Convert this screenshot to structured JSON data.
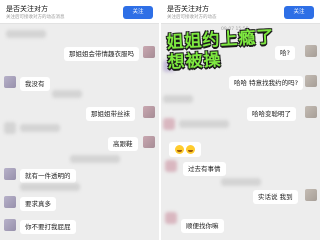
{
  "left": {
    "follow_title": "是否关注对方",
    "follow_sub": "关注后可接收对方的动态消息",
    "follow_btn": "关注",
    "time": "",
    "messages": {
      "m1": "那姐姐会带情趣衣服吗",
      "m2": "我没有",
      "m3": "那姐姐带丝袜",
      "m4": "高跟鞋",
      "m5": "就有一件透明的",
      "m6": "要求真多",
      "m7": "你不要打我屁屁"
    }
  },
  "right": {
    "follow_title": "是否关注对方",
    "follow_sub": "关注后可接收对方的动态",
    "follow_btn": "关注",
    "time": "09-07 15:58",
    "overlay_text": "姐姐约上瘾了想被操",
    "messages": {
      "m1": "哈?",
      "m2": "哈哈 特意找我约的吗?",
      "m3": "哈哈变聪明了",
      "m4": "过去有事情",
      "m5": "实话说 我到",
      "m6": "顺便找你嘛"
    }
  },
  "emoji_icon": "smile-emoji-icon",
  "colors": {
    "accent": "#2e6fe6",
    "self_bubble": "#95ec69",
    "other_bubble": "#ffffff",
    "overlay_text": "#7ee840"
  }
}
